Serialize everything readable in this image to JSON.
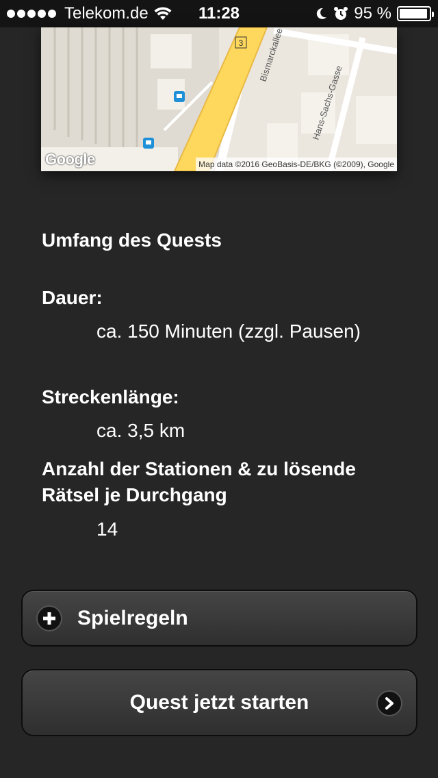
{
  "status_bar": {
    "carrier": "Telekom.de",
    "time": "11:28",
    "battery_percent": "95 %",
    "battery_level": 0.95,
    "icons": [
      "signal-dots-icon",
      "wifi-icon",
      "moon-icon",
      "alarm-icon",
      "battery-icon"
    ]
  },
  "map": {
    "logo": "Google",
    "credit": "Map data ©2016 GeoBasis-DE/BKG (©2009), Google",
    "street_labels": [
      "Bismarckallee",
      "Hans-Sachs-Gasse"
    ],
    "route_badge": "3"
  },
  "quest": {
    "section_title": "Umfang des Quests",
    "duration_label": "Dauer:",
    "duration_value": "ca. 150 Minuten (zzgl. Pausen)",
    "distance_label": "Streckenlänge:",
    "distance_value": "ca. 3,5 km",
    "stations_label": "Anzahl der Stationen & zu lösende Rätsel je Durchgang",
    "stations_value": "14"
  },
  "buttons": {
    "rules_label": "Spielregeln",
    "start_label": "Quest jetzt starten"
  },
  "colors": {
    "background": "#262626",
    "map_road": "#fdd85c"
  }
}
